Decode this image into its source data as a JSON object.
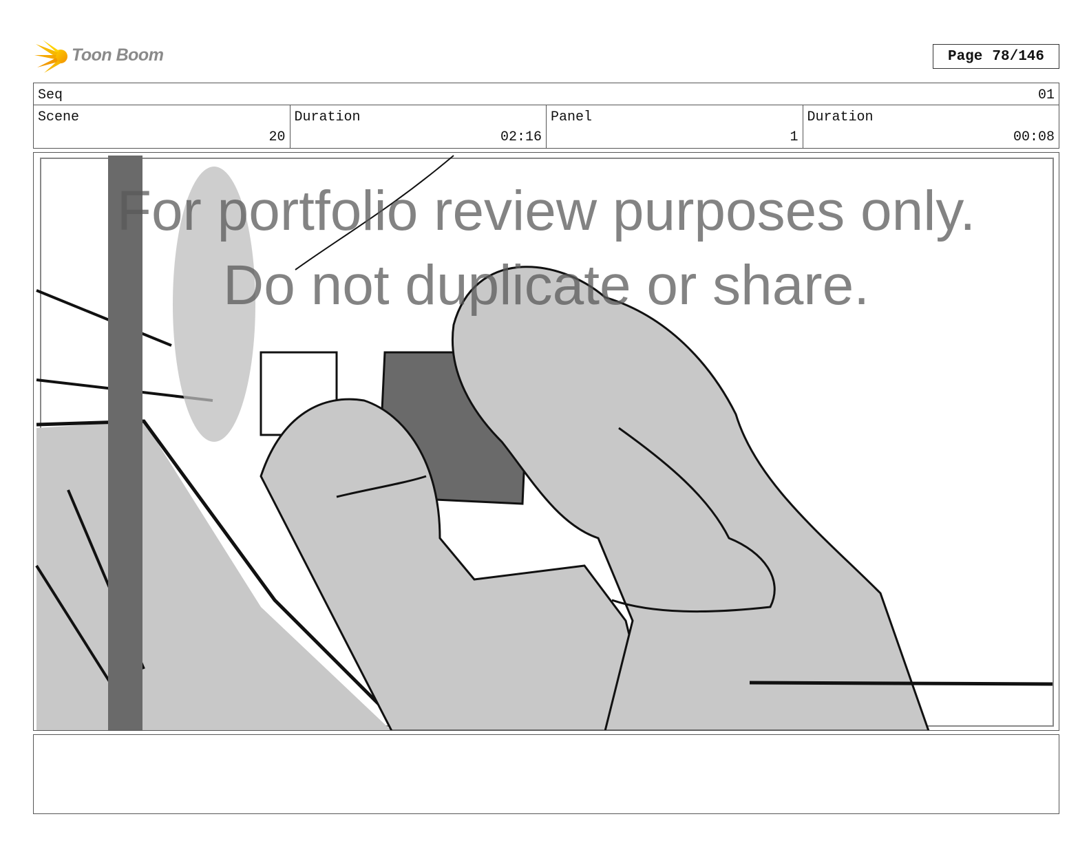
{
  "brand": {
    "name": "Toon Boom",
    "logo_icon": "starburst-logo-icon",
    "accent": "#f2b705"
  },
  "page": {
    "label": "Page",
    "value": "78/146"
  },
  "sequence": {
    "label": "Seq",
    "value": "01"
  },
  "info": {
    "scene_label": "Scene",
    "scene_value": "20",
    "scene_duration_label": "Duration",
    "scene_duration_value": "02:16",
    "panel_label": "Panel",
    "panel_value": "1",
    "panel_duration_label": "Duration",
    "panel_duration_value": "00:08"
  },
  "watermark": {
    "line1": "For portfolio review purposes only.",
    "line2": "Do not duplicate or share."
  },
  "colors": {
    "sketch_fill": "#c8c8c8",
    "dark_fill": "#6a6a6a",
    "line": "#111111"
  }
}
